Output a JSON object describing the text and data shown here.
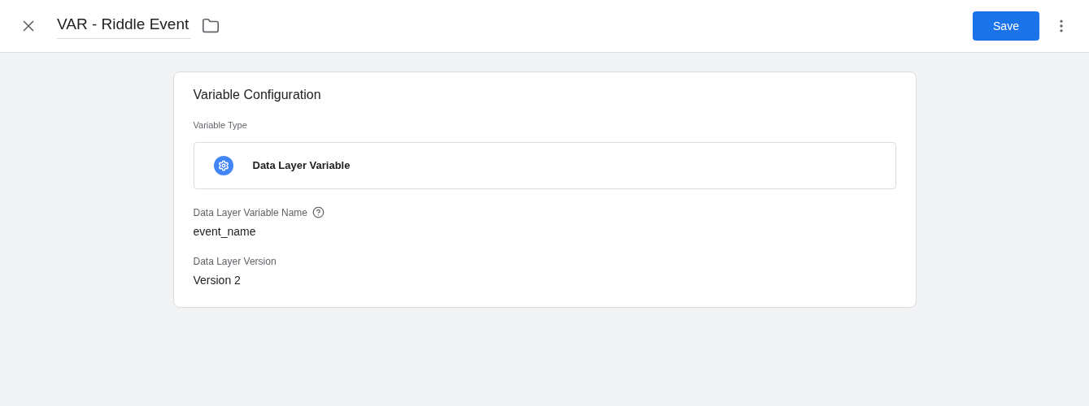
{
  "header": {
    "title": "VAR - Riddle Event",
    "save_button": "Save"
  },
  "card": {
    "title": "Variable Configuration",
    "variable_type": {
      "label": "Variable Type",
      "value": "Data Layer Variable"
    },
    "fields": [
      {
        "label": "Data Layer Variable Name",
        "help": true,
        "value": "event_name"
      },
      {
        "label": "Data Layer Version",
        "help": false,
        "value": "Version 2"
      }
    ]
  }
}
